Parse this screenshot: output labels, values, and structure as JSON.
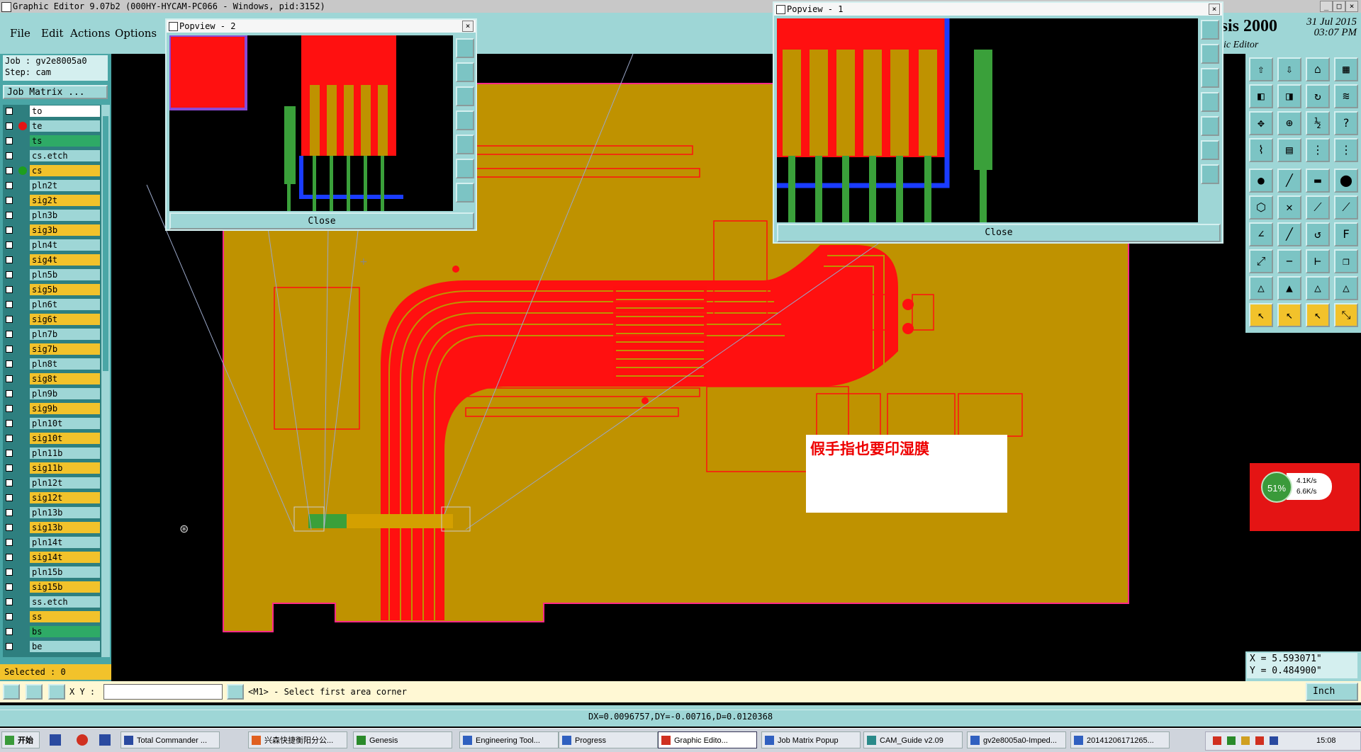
{
  "window": {
    "title": "Graphic Editor 9.07b2 (000HY-HYCAM-PC066 - Windows, pid:3152)"
  },
  "menu": [
    "File",
    "Edit",
    "Actions",
    "Options"
  ],
  "brand": {
    "title": "esis 2000",
    "subtitle": "phic Editor"
  },
  "datetime": {
    "date": "31 Jul 2015",
    "time": "03:07 PM"
  },
  "job": {
    "job_line": "Job : gv2e8005a0",
    "step_line": "Step: cam",
    "matrix_button": "Job Matrix ..."
  },
  "layers": [
    {
      "name": "to",
      "color": "#ffffff",
      "marker": ""
    },
    {
      "name": "te",
      "color": "#9ed6d6",
      "marker": "#e41414"
    },
    {
      "name": "ts",
      "color": "#2eaa66",
      "marker": ""
    },
    {
      "name": "cs.etch",
      "color": "#9ed6d6",
      "marker": ""
    },
    {
      "name": "cs",
      "color": "#f2c22b",
      "marker": "#1e9e1e"
    },
    {
      "name": "pln2t",
      "color": "#9ed6d6",
      "marker": ""
    },
    {
      "name": "sig2t",
      "color": "#f2c22b",
      "marker": ""
    },
    {
      "name": "pln3b",
      "color": "#9ed6d6",
      "marker": ""
    },
    {
      "name": "sig3b",
      "color": "#f2c22b",
      "marker": ""
    },
    {
      "name": "pln4t",
      "color": "#9ed6d6",
      "marker": ""
    },
    {
      "name": "sig4t",
      "color": "#f2c22b",
      "marker": ""
    },
    {
      "name": "pln5b",
      "color": "#9ed6d6",
      "marker": ""
    },
    {
      "name": "sig5b",
      "color": "#f2c22b",
      "marker": ""
    },
    {
      "name": "pln6t",
      "color": "#9ed6d6",
      "marker": ""
    },
    {
      "name": "sig6t",
      "color": "#f2c22b",
      "marker": ""
    },
    {
      "name": "pln7b",
      "color": "#9ed6d6",
      "marker": ""
    },
    {
      "name": "sig7b",
      "color": "#f2c22b",
      "marker": ""
    },
    {
      "name": "pln8t",
      "color": "#9ed6d6",
      "marker": ""
    },
    {
      "name": "sig8t",
      "color": "#f2c22b",
      "marker": ""
    },
    {
      "name": "pln9b",
      "color": "#9ed6d6",
      "marker": ""
    },
    {
      "name": "sig9b",
      "color": "#f2c22b",
      "marker": ""
    },
    {
      "name": "pln10t",
      "color": "#9ed6d6",
      "marker": ""
    },
    {
      "name": "sig10t",
      "color": "#f2c22b",
      "marker": ""
    },
    {
      "name": "pln11b",
      "color": "#9ed6d6",
      "marker": ""
    },
    {
      "name": "sig11b",
      "color": "#f2c22b",
      "marker": ""
    },
    {
      "name": "pln12t",
      "color": "#9ed6d6",
      "marker": ""
    },
    {
      "name": "sig12t",
      "color": "#f2c22b",
      "marker": ""
    },
    {
      "name": "pln13b",
      "color": "#9ed6d6",
      "marker": ""
    },
    {
      "name": "sig13b",
      "color": "#f2c22b",
      "marker": ""
    },
    {
      "name": "pln14t",
      "color": "#9ed6d6",
      "marker": ""
    },
    {
      "name": "sig14t",
      "color": "#f2c22b",
      "marker": ""
    },
    {
      "name": "pln15b",
      "color": "#9ed6d6",
      "marker": ""
    },
    {
      "name": "sig15b",
      "color": "#f2c22b",
      "marker": ""
    },
    {
      "name": "ss.etch",
      "color": "#9ed6d6",
      "marker": ""
    },
    {
      "name": "ss",
      "color": "#f2c22b",
      "marker": ""
    },
    {
      "name": "bs",
      "color": "#2eaa66",
      "marker": ""
    },
    {
      "name": "be",
      "color": "#9ed6d6",
      "marker": ""
    }
  ],
  "selected": "Selected : 0",
  "popups": {
    "popview2": {
      "title": "Popview - 2",
      "close_label": "Close"
    },
    "popview1": {
      "title": "Popview - 1",
      "close_label": "Close"
    }
  },
  "annotation": "假手指也要印湿膜",
  "network": {
    "percent": "51%",
    "up": "4.1K/s",
    "down": "6.6K/s"
  },
  "coords": {
    "x": "X = 5.593071\"",
    "y": "Y = 0.484900\""
  },
  "bottom": {
    "xy_label": "X Y :",
    "message": "<M1> - Select first area corner",
    "units": "Inch"
  },
  "status": "DX=0.0096757,DY=-0.00716,D=0.0120368",
  "taskbar": {
    "start": "开始",
    "tasks": [
      {
        "label": "Total Commander ...",
        "active": false
      },
      {
        "label": "兴森快捷衡阳分公...",
        "active": false
      },
      {
        "label": "Genesis",
        "active": false
      },
      {
        "label": "Engineering Tool...",
        "active": false
      },
      {
        "label": "Progress",
        "active": false
      },
      {
        "label": "Graphic Edito...",
        "active": true
      },
      {
        "label": "Job Matrix Popup",
        "active": false
      },
      {
        "label": "CAM_Guide v2.09",
        "active": false
      },
      {
        "label": "gv2e8005a0-Imped...",
        "active": false
      },
      {
        "label": "20141206171265...",
        "active": false
      }
    ],
    "clock": "15:08"
  },
  "colors": {
    "copper": "#bf9200",
    "trace_red": "#ff1010",
    "panel": "#9ed6d6",
    "panel_dark": "#4aa6a6",
    "highlight": "#f2c22b"
  }
}
